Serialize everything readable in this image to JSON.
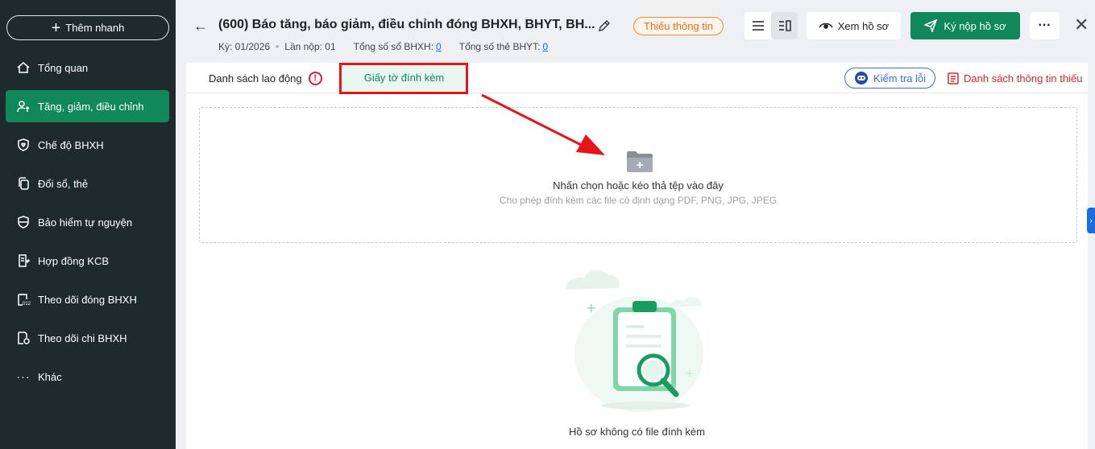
{
  "sidebar": {
    "quick_add_label": "Thêm nhanh",
    "items": [
      {
        "label": "Tổng quan",
        "icon": "home-icon"
      },
      {
        "label": "Tăng, giảm, điều chỉnh",
        "icon": "user-arrow-icon",
        "active": true
      },
      {
        "label": "Chế độ BHXH",
        "icon": "shield-heart-icon"
      },
      {
        "label": "Đổi sổ, thẻ",
        "icon": "copy-icon"
      },
      {
        "label": "Bảo hiểm tự nguyện",
        "icon": "shield-icon"
      },
      {
        "label": "Hợp đồng KCB",
        "icon": "contract-icon"
      },
      {
        "label": "Theo dõi đóng BHXH",
        "icon": "calendar-icon"
      },
      {
        "label": "Theo dõi chi BHXH",
        "icon": "document-money-icon"
      },
      {
        "label": "Khác",
        "icon": "more-icon"
      }
    ]
  },
  "header": {
    "title": "(600) Báo tăng, báo giảm, điều chỉnh đóng BHXH, BHYT, BH...",
    "status": "Thiếu thông tin",
    "meta": {
      "period": "Kỳ: 01/2026",
      "submit_count": "Lần nộp: 01",
      "bhxh_label": "Tổng số sổ BHXH:",
      "bhxh_value": "0",
      "bhyt_label": "Tổng số thẻ BHYT:",
      "bhyt_value": "0"
    },
    "view_button": "Xem hồ sơ",
    "submit_button": "Ký nộp hồ sơ"
  },
  "tabs": {
    "employees": "Danh sách lao động",
    "attachments": "Giấy tờ đính kèm"
  },
  "toolbar": {
    "check_errors": "Kiểm tra lỗi",
    "missing_info": "Danh sách thông tin thiếu"
  },
  "dropzone": {
    "title": "Nhấn chọn hoặc kéo thả tệp vào đây",
    "subtitle": "Cho phép đính kèm các file có định dạng PDF, PNG, JPG, JPEG"
  },
  "empty_state": {
    "text": "Hồ sơ không có file đính kèm"
  },
  "colors": {
    "sidebar_bg": "#1f2a2a",
    "brand_green": "#10885c",
    "warning_orange": "#e07020",
    "error_red": "#e21f26",
    "link_blue": "#1a6de0"
  }
}
